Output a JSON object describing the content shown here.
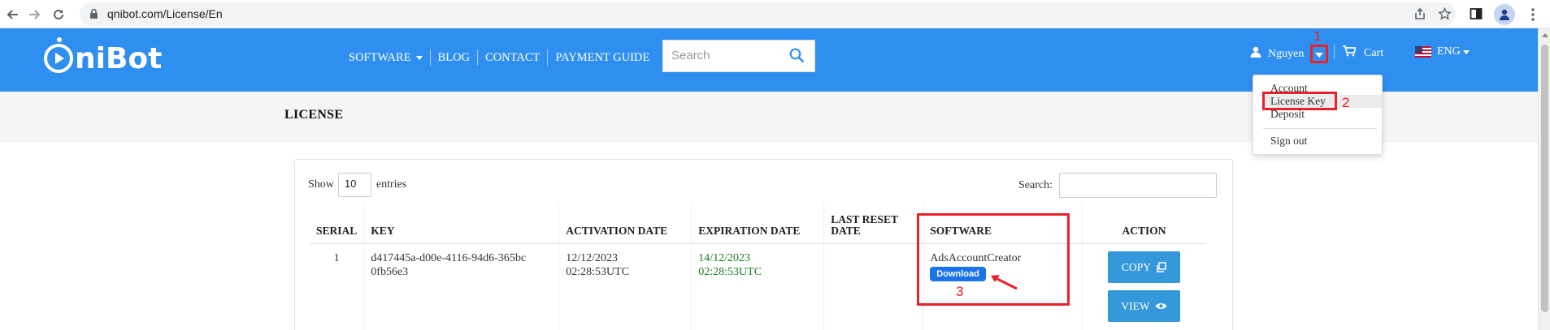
{
  "browser": {
    "url": "qnibot.com/License/En"
  },
  "site": {
    "logo_text": "niBot",
    "nav": [
      {
        "label": "SOFTWARE",
        "has_caret": true
      },
      {
        "label": "BLOG"
      },
      {
        "label": "CONTACT"
      },
      {
        "label": "PAYMENT GUIDE"
      }
    ],
    "search_placeholder": "Search",
    "user_name": "Nguyen",
    "cart_label": "Cart",
    "lang_label": "ENG",
    "accent_color": "#2f8ff0"
  },
  "user_menu": {
    "items": [
      "Account",
      "License Key",
      "Deposit",
      "Sign out"
    ]
  },
  "annotations": {
    "step1": "1",
    "step2": "2",
    "step3": "3",
    "highlight_color": "#e8212a"
  },
  "page": {
    "title": "LICENSE"
  },
  "table_controls": {
    "show_label": "Show",
    "entries_value": "10",
    "entries_label": "entries",
    "search_label": "Search:"
  },
  "license_table": {
    "headers": [
      "SERIAL",
      "KEY",
      "ACTIVATION DATE",
      "EXPIRATION DATE",
      "LAST RESET DATE",
      "SOFTWARE",
      "ACTION"
    ],
    "rows": [
      {
        "serial": "1",
        "key": "d417445a-d00e-4116-94d6-365bc0fb56e3",
        "activation_date": "12/12/2023",
        "activation_time": "02:28:53UTC",
        "expiration_date": "14/12/2023",
        "expiration_time": "02:28:53UTC",
        "last_reset_date": "",
        "software": "AdsAccountCreator",
        "download_label": "Download",
        "copy_label": "COPY",
        "view_label": "VIEW"
      }
    ]
  }
}
